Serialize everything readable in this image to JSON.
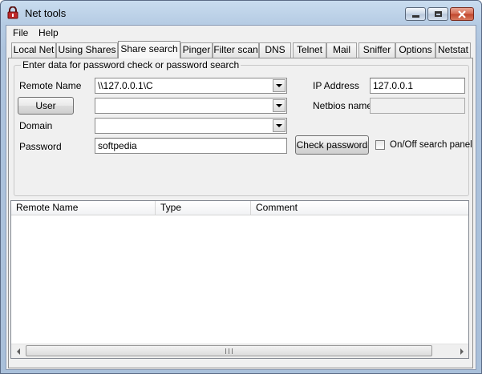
{
  "window": {
    "title": "Net tools"
  },
  "menu": {
    "file": "File",
    "help": "Help"
  },
  "tabs": [
    {
      "label": "Local Net"
    },
    {
      "label": "Using Shares"
    },
    {
      "label": "Share search"
    },
    {
      "label": "Pinger"
    },
    {
      "label": "Filter scan"
    },
    {
      "label": "DNS"
    },
    {
      "label": "Telnet"
    },
    {
      "label": "Mail"
    },
    {
      "label": "Sniffer"
    },
    {
      "label": "Options"
    },
    {
      "label": "Netstat"
    }
  ],
  "active_tab": "Share search",
  "group": {
    "title": "Enter data for password check or password search"
  },
  "form": {
    "remote_name_label": "Remote Name",
    "remote_name_value": "\\\\127.0.0.1\\C",
    "user_button": "User",
    "user_value": "",
    "domain_label": "Domain",
    "domain_value": "",
    "password_label": "Password",
    "password_value": "softpedia",
    "ip_label": "IP Address",
    "ip_value": "127.0.0.1",
    "netbios_label": "Netbios name",
    "netbios_value": "",
    "check_password_button": "Check password",
    "search_panel_label": "On/Off search panel"
  },
  "list": {
    "columns": [
      {
        "label": "Remote Name"
      },
      {
        "label": "Type"
      },
      {
        "label": "Comment"
      }
    ]
  },
  "icons": {
    "app": "lock-icon",
    "minimize": "minimize-icon",
    "maximize": "maximize-icon",
    "close": "close-icon"
  },
  "colors": {
    "close_button": "#c8462e",
    "title_bar": "#b5cbe3"
  }
}
